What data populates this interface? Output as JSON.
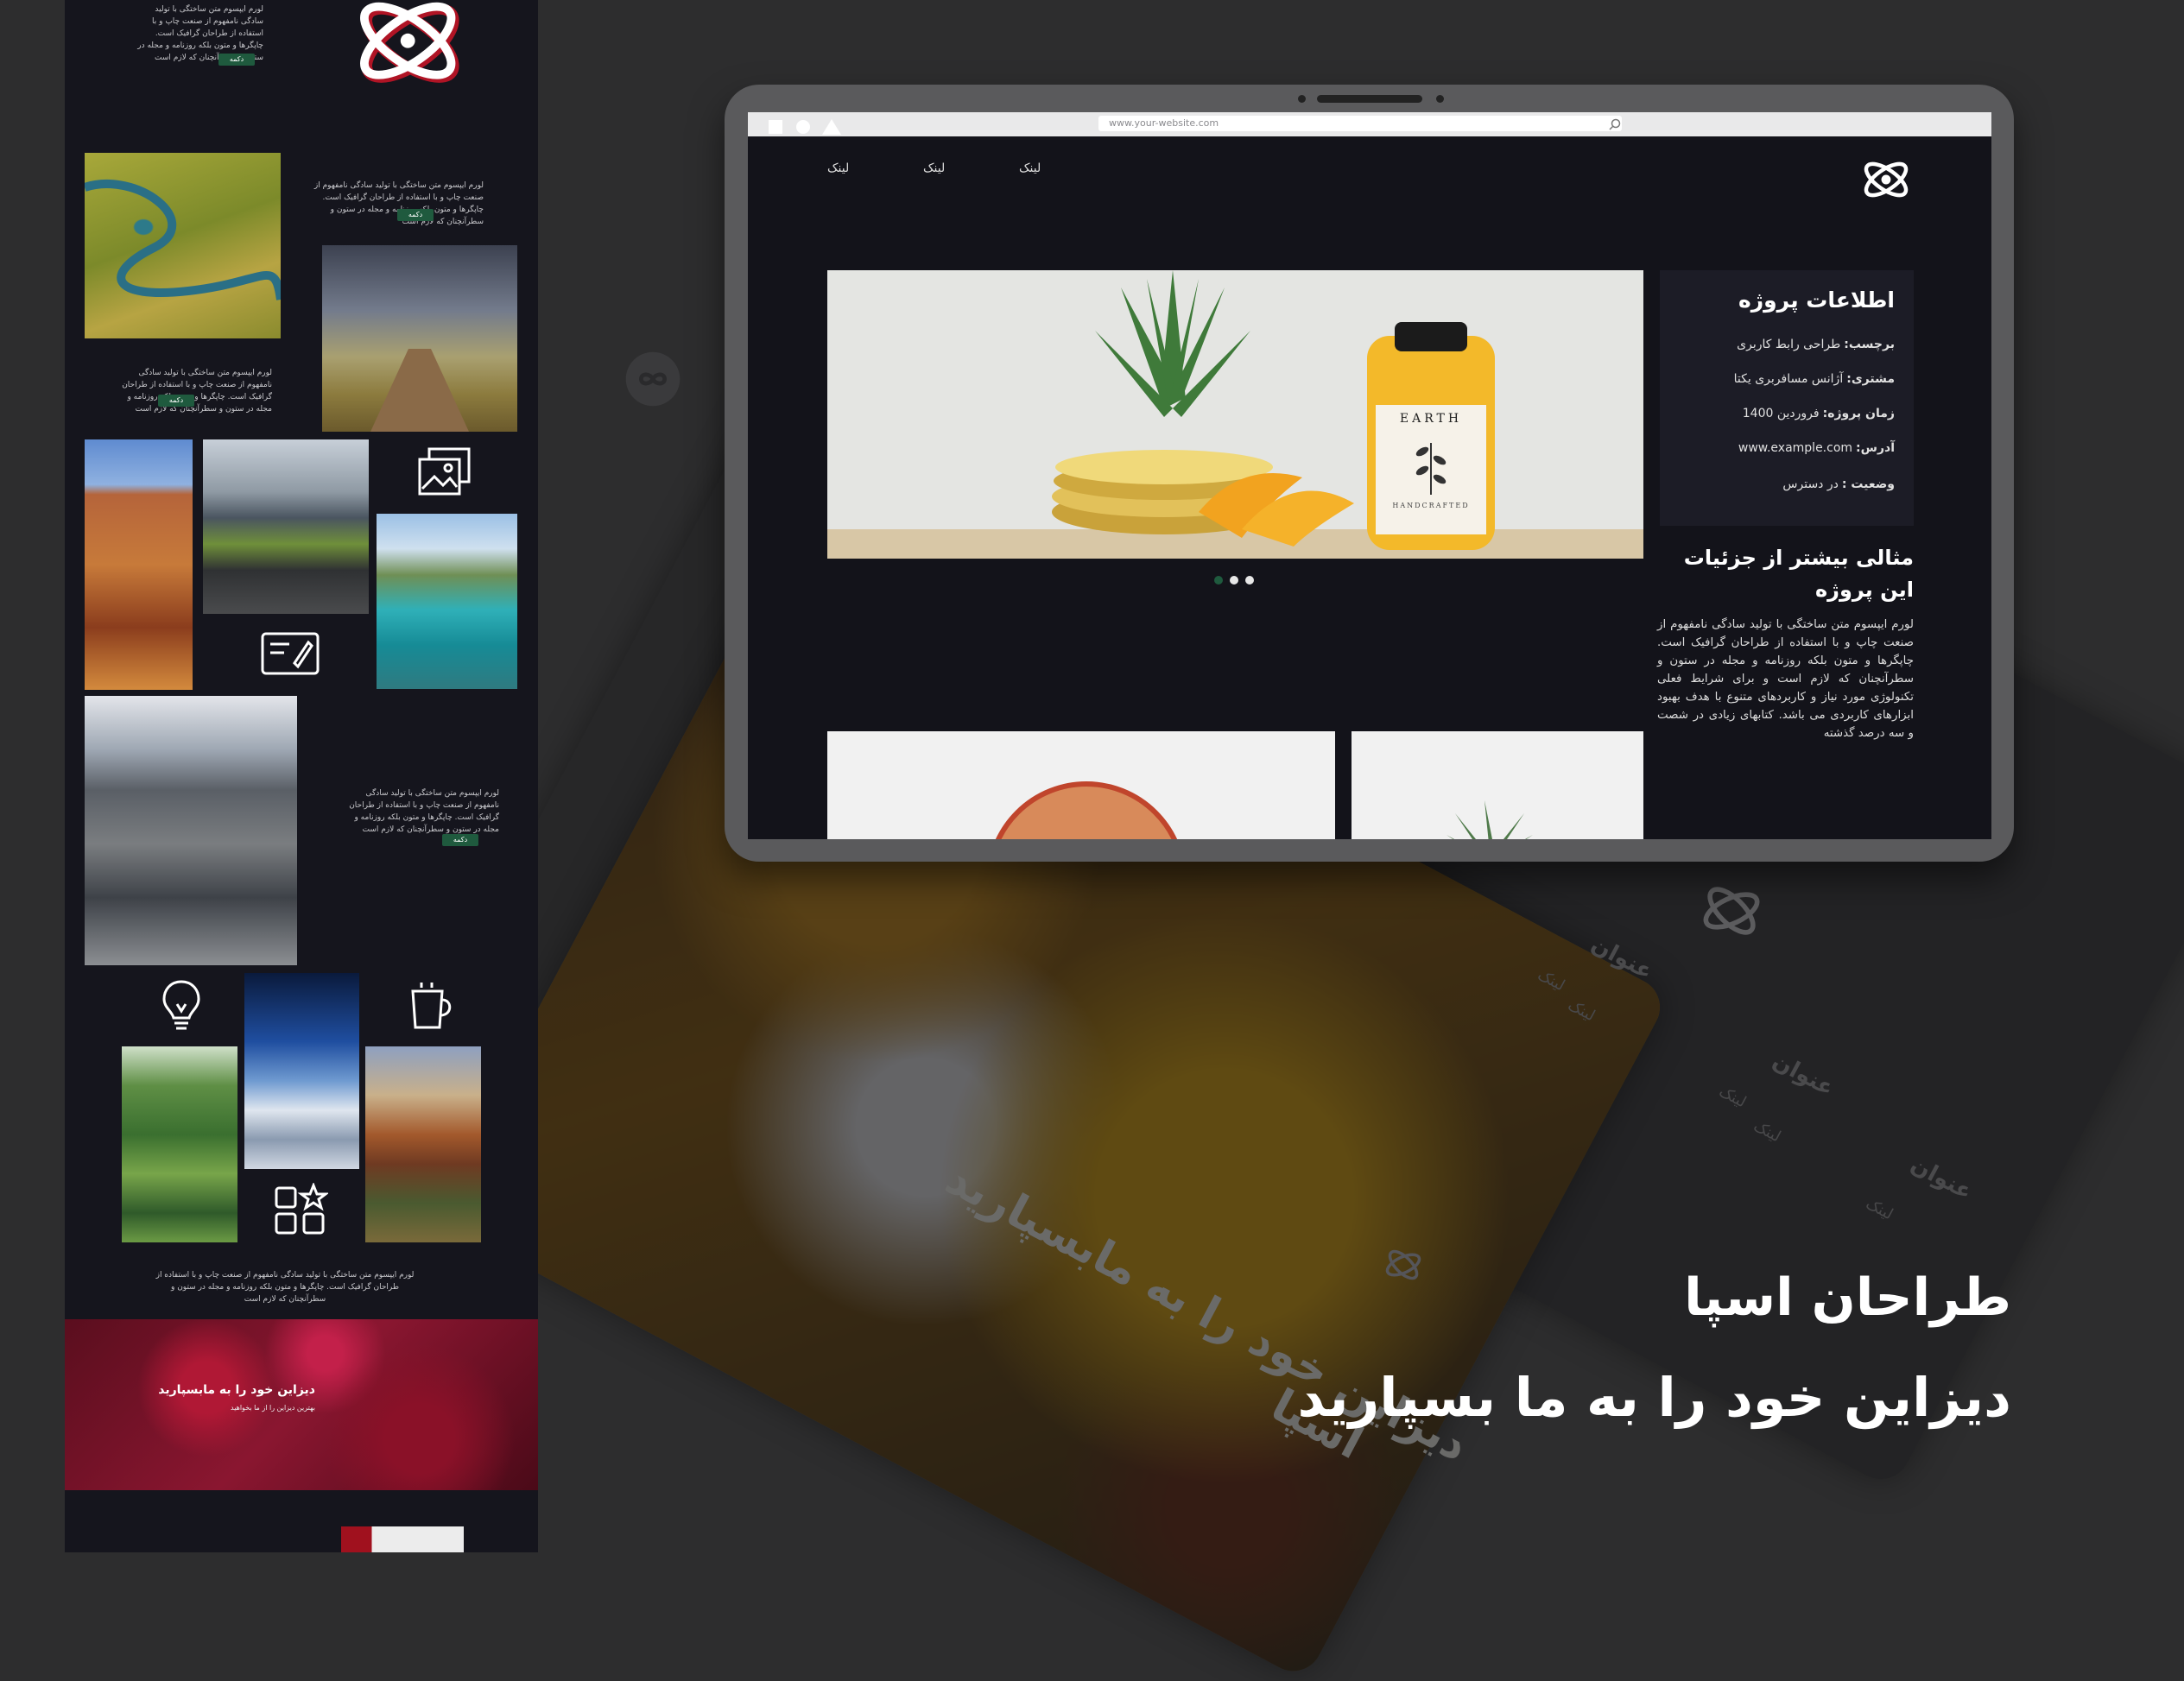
{
  "brand": {
    "title": "طراحان اسپا",
    "tagline": "دیزاین خود را به ما بسپارید"
  },
  "browser": {
    "url": "www.your-website.com"
  },
  "site": {
    "nav_links": [
      "لینک",
      "لینک",
      "لینک"
    ],
    "project_info": {
      "title": "اطلاعات پروژه",
      "rows": [
        {
          "label": "برچسب:",
          "value": "طراحی رابط کاربری"
        },
        {
          "label": "مشتری:",
          "value": "آژانس مسافربری یکتا"
        },
        {
          "label": "زمان پروژه:",
          "value": "فروردین 1400"
        },
        {
          "label": "آدرس:",
          "value": "www.example.com"
        },
        {
          "label": "وضعیت :",
          "value": "در دسترس"
        }
      ]
    },
    "details": {
      "title": "مثالی بیشتر از جزئیات این پروژه",
      "body": "لورم ایپسوم متن ساختگی با تولید سادگی نامفهوم از صنعت چاپ و با استفاده از طراحان گرافیک است. چاپگرها و متون بلکه روزنامه و مجله در ستون و سطرآنچنان که لازم است و برای شرایط فعلی تکنولوژی مورد نیاز و کاربردهای متنوع با هدف بهبود ابزارهای کاربردی می باشد. کتابهای زیادی در شصت و سه درصد گذشته"
    },
    "hero_label": "EARTH",
    "hero_sub": "HANDCRAFTED",
    "carousel": {
      "count": 3,
      "active": 0
    }
  },
  "strip": {
    "lorem": "لورم ایپسوم متن ساختگی با تولید سادگی نامفهوم از صنعت چاپ و با استفاده از طراحان گرافیک است. چاپگرها و متون بلکه روزنامه و مجله در ستون و سطرآنچنان که لازم است",
    "button": "دکمه",
    "banner_title": "دیزاین خود را به مابسپارید",
    "banner_sub": "بهترین دیزاین را از ما بخواهید"
  },
  "background": {
    "heading": "عنوان",
    "link": "لینک",
    "tilted_title": "دیزاین خود را به مابسپارید",
    "tilted_brand": "اسپا"
  },
  "colors": {
    "page_bg": "#2d2d2e",
    "site_bg": "#13131a",
    "panel_bg": "#1c1c26",
    "button_green": "#1f5a3e"
  }
}
